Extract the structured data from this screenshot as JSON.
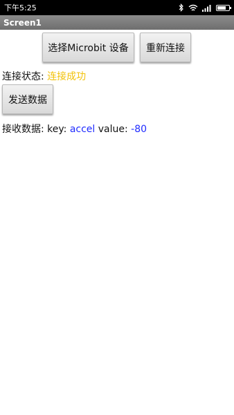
{
  "status_bar": {
    "time": "下午5:25",
    "icons": [
      "bluetooth-icon",
      "wifi-icon",
      "signal-icon",
      "battery-icon"
    ]
  },
  "title_bar": {
    "title": "Screen1"
  },
  "buttons": {
    "select_device": "选择Microbit 设备",
    "reconnect": "重新连接",
    "send_data": "发送数据"
  },
  "connection": {
    "label": "连接状态: ",
    "status": "连接成功",
    "status_color": "#f2c20a"
  },
  "received": {
    "label": "接收数据: key: ",
    "key": "accel",
    "value_label": " value: ",
    "value": "-80",
    "value_color": "#1f2bff"
  }
}
